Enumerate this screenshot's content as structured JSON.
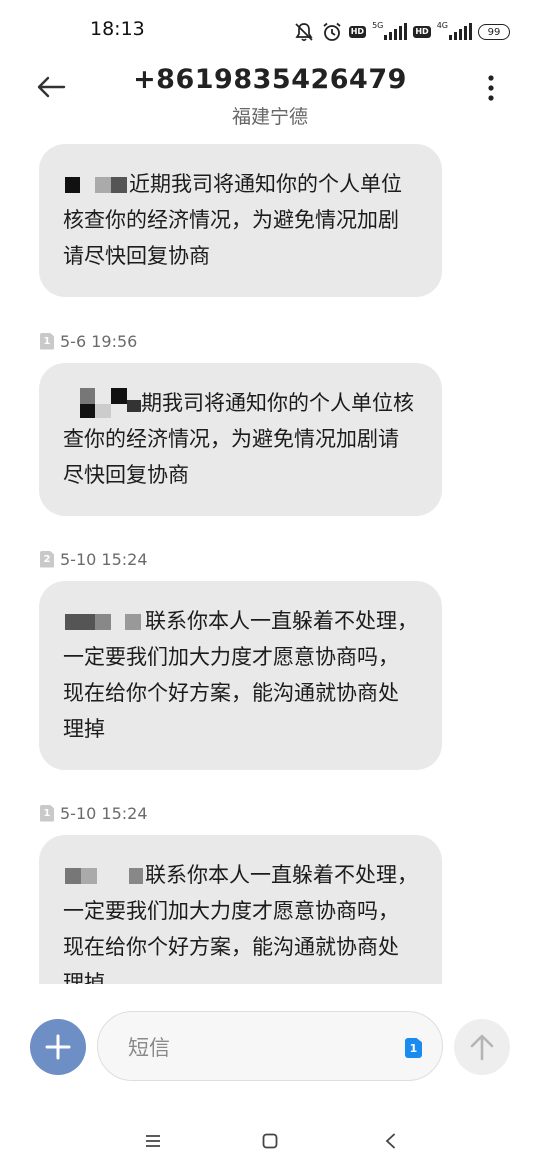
{
  "status_bar": {
    "time": "18:13",
    "icons": [
      "mute-icon",
      "alarm-icon",
      "hd-icon",
      "signal-5g-icon",
      "hd-icon",
      "signal-4g-icon",
      "battery-icon"
    ],
    "hd_label": "HD",
    "net1_label": "5G",
    "net2_label": "4G",
    "battery_level": "99"
  },
  "header": {
    "title": "+8619835426479",
    "subtitle": "福建宁德"
  },
  "messages": [
    {
      "timestamp": "",
      "sim": "",
      "text": "近期我司将通知你的个人单位核查你的经济情况，为避免情况加剧请尽快回复协商"
    },
    {
      "timestamp": "5-6 19:56",
      "sim": "1",
      "text": "期我司将通知你的个人单位核查你的经济情况，为避免情况加剧请尽快回复协商"
    },
    {
      "timestamp": "5-10 15:24",
      "sim": "2",
      "text": "联系你本人一直躲着不处理，一定要我们加大力度才愿意协商吗，现在给你个好方案，能沟通就协商处理掉"
    },
    {
      "timestamp": "5-10 15:24",
      "sim": "1",
      "text": "联系你本人一直躲着不处理，一定要我们加大力度才愿意协商吗，现在给你个好方案，能沟通就协商处理掉"
    }
  ],
  "compose": {
    "placeholder": "短信",
    "sim": "1"
  },
  "colors": {
    "bubble": "#e9e9e9",
    "add_button": "#6d8fc5",
    "sim_select": "#1a8cf0"
  }
}
